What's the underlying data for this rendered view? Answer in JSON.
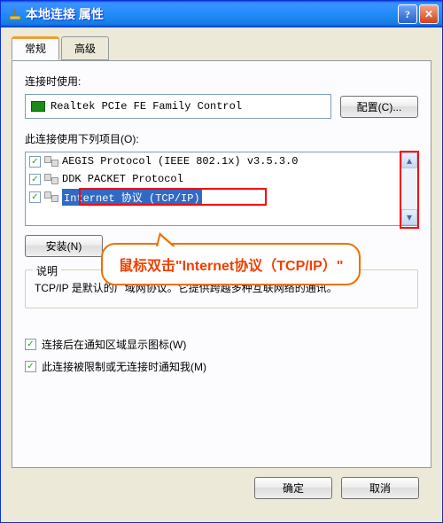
{
  "title": "本地连接 属性",
  "tabs": {
    "general": "常规",
    "advanced": "高级"
  },
  "connect_using_label": "连接时使用:",
  "adapter": "Realtek PCIe FE Family Control",
  "configure_btn": "配置(C)...",
  "items_label": "此连接使用下列项目(O):",
  "list": [
    {
      "checked": true,
      "label": "AEGIS Protocol (IEEE 802.1x) v3.5.3.0"
    },
    {
      "checked": true,
      "label": "DDK PACKET Protocol"
    },
    {
      "checked": true,
      "label": "Internet 协议 (TCP/IP)",
      "selected": true
    }
  ],
  "install_btn": "安装(N)",
  "desc_title": "说明",
  "desc_text": "TCP/IP 是默认的广域网协议。它提供跨越多种互联网络的通讯。",
  "check1": "连接后在通知区域显示图标(W)",
  "check2": "此连接被限制或无连接时通知我(M)",
  "ok_btn": "确定",
  "cancel_btn": "取消",
  "callout": "鼠标双击\"Internet协议（TCP/IP）\"",
  "scroll": {
    "up": "▴",
    "down": "▾"
  },
  "help_symbol": "?",
  "close_symbol": "✕",
  "checkmark": "✓"
}
